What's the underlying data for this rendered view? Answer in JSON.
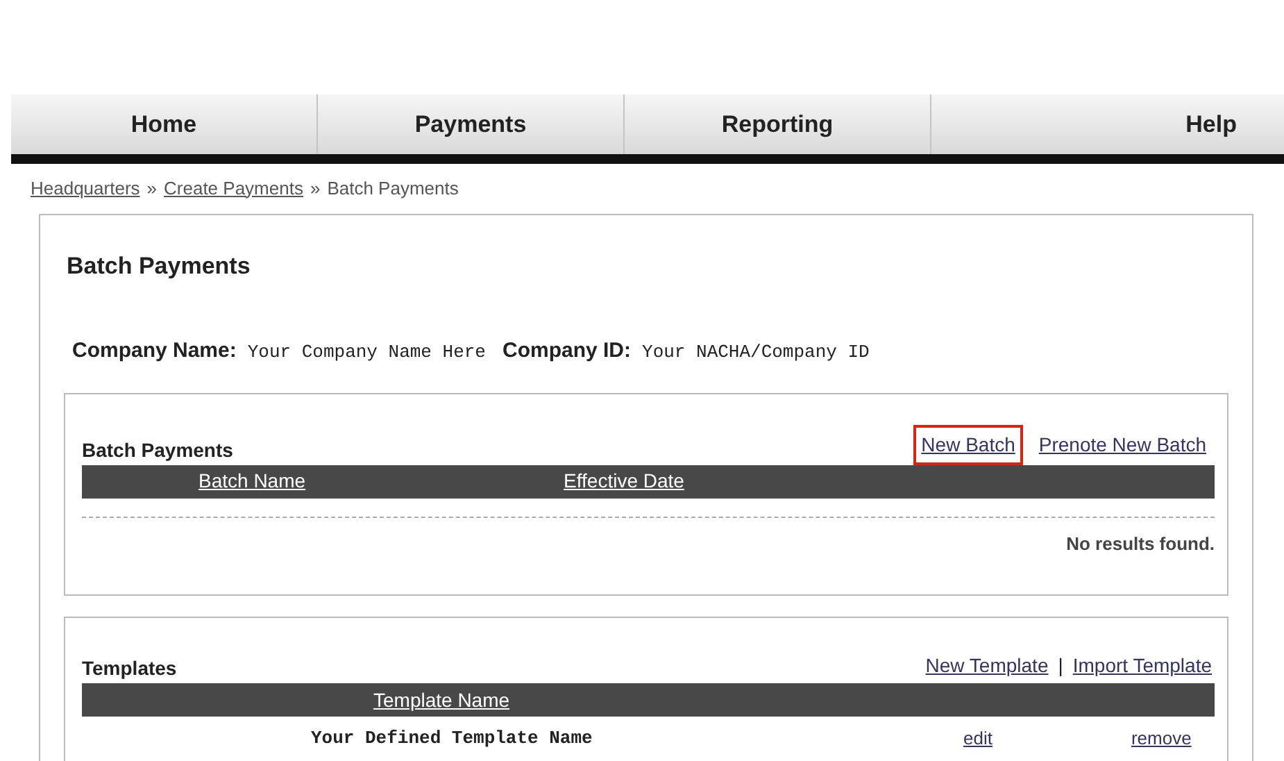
{
  "nav": [
    {
      "label": "Home"
    },
    {
      "label": "Payments"
    },
    {
      "label": "Reporting"
    },
    {
      "label": "Help"
    }
  ],
  "breadcrumb": [
    {
      "label": "Headquarters",
      "link": true
    },
    {
      "label": "Create Payments",
      "link": true
    },
    {
      "label": "Batch Payments",
      "link": false
    }
  ],
  "breadcrumb_separator": "»",
  "title": "Batch Payments",
  "company": {
    "name_label": "Company Name:",
    "name_value": "Your Company Name Here",
    "id_label": "Company ID:",
    "id_value": "Your NACHA/Company ID"
  },
  "batch_panel": {
    "title": "Batch Payments",
    "links": [
      {
        "label": "New Batch",
        "highlighted": true
      },
      {
        "label": "Prenote New Batch",
        "highlighted": false
      }
    ],
    "columns": [
      "Batch Name",
      "Effective Date"
    ],
    "empty_text": "No results found."
  },
  "templates_panel": {
    "title": "Templates",
    "links": [
      {
        "label": "New Template"
      },
      {
        "label": "Import Template"
      }
    ],
    "link_separator": "|",
    "columns": [
      "Template Name"
    ],
    "rows": [
      {
        "name": "Your Defined Template Name",
        "actions": [
          "edit",
          "remove"
        ]
      }
    ]
  }
}
